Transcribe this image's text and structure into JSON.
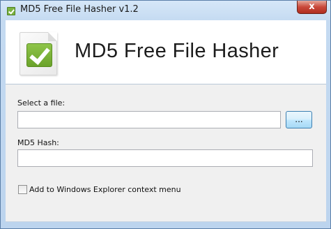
{
  "window": {
    "title": "MD5 Free File Hasher v1.2",
    "close_glyph": "x"
  },
  "header": {
    "title": "MD5 Free File Hasher",
    "logo_icon": "checkmark-document-icon"
  },
  "form": {
    "file_label": "Select a file:",
    "file_value": "",
    "browse_label": "...",
    "hash_label": "MD5 Hash:",
    "hash_value": "",
    "context_menu_label": "Add to Windows Explorer context menu",
    "context_menu_checked": false
  },
  "colors": {
    "accent_green": "#7cb342",
    "close_red": "#c9483a",
    "button_blue": "#3c7fb1"
  }
}
